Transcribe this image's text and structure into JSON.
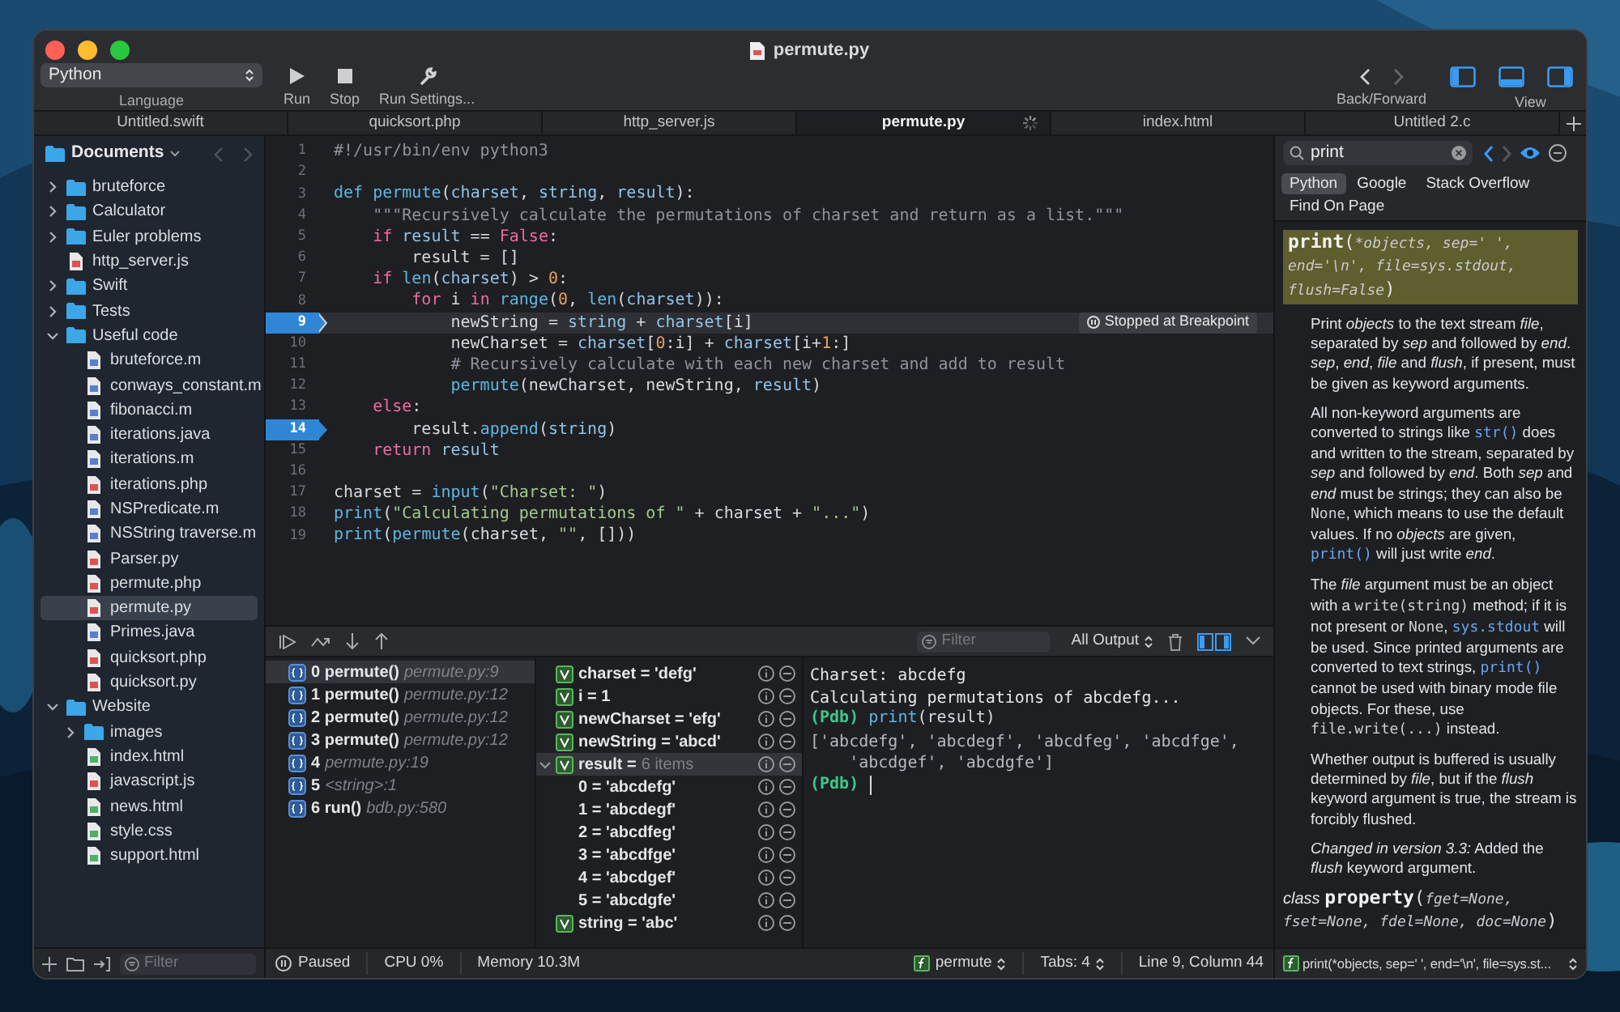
{
  "window": {
    "title": "permute.py"
  },
  "toolbar": {
    "language": "Python",
    "language_label": "Language",
    "buttons": [
      {
        "kind": "run",
        "label": "Run"
      },
      {
        "kind": "stop",
        "label": "Stop"
      },
      {
        "kind": "settings",
        "label": "Run Settings..."
      }
    ],
    "nav_label": "Back/Forward",
    "view_label": "View",
    "view_toggles": [
      {
        "kind": "left",
        "on": true
      },
      {
        "kind": "bottom",
        "on": true
      },
      {
        "kind": "right",
        "on": true
      }
    ]
  },
  "tabs": [
    {
      "label": "Untitled.swift",
      "selected": false,
      "busy": false
    },
    {
      "label": "quicksort.php",
      "selected": false,
      "busy": false
    },
    {
      "label": "http_server.js",
      "selected": false,
      "busy": false
    },
    {
      "label": "permute.py",
      "selected": true,
      "busy": true
    },
    {
      "label": "index.html",
      "selected": false,
      "busy": false
    },
    {
      "label": "Untitled 2.c",
      "selected": false,
      "busy": false
    }
  ],
  "sidebar": {
    "title": "Documents",
    "filter_placeholder": "Filter",
    "items": [
      {
        "label": "bruteforce",
        "kind": "folder",
        "expanded": false,
        "selected": false
      },
      {
        "label": "Calculator",
        "kind": "folder",
        "expanded": false,
        "selected": false
      },
      {
        "label": "Euler problems",
        "kind": "folder",
        "expanded": false,
        "selected": false
      },
      {
        "label": "http_server.js",
        "kind": "js",
        "selected": false
      },
      {
        "label": "Swift",
        "kind": "folder",
        "expanded": false,
        "selected": false
      },
      {
        "label": "Tests",
        "kind": "folder",
        "expanded": false,
        "selected": false
      },
      {
        "label": "Useful code",
        "kind": "folder",
        "expanded": true,
        "selected": false,
        "children": [
          {
            "label": "bruteforce.m",
            "kind": "m",
            "selected": false
          },
          {
            "label": "conways_constant.m",
            "kind": "m",
            "selected": false
          },
          {
            "label": "fibonacci.m",
            "kind": "m",
            "selected": false
          },
          {
            "label": "iterations.java",
            "kind": "java",
            "selected": false
          },
          {
            "label": "iterations.m",
            "kind": "m",
            "selected": false
          },
          {
            "label": "iterations.php",
            "kind": "php",
            "selected": false
          },
          {
            "label": "NSPredicate.m",
            "kind": "m",
            "selected": false
          },
          {
            "label": "NSString traverse.m",
            "kind": "m",
            "selected": false
          },
          {
            "label": "Parser.py",
            "kind": "py",
            "selected": false
          },
          {
            "label": "permute.php",
            "kind": "php",
            "selected": false
          },
          {
            "label": "permute.py",
            "kind": "py",
            "selected": true
          },
          {
            "label": "Primes.java",
            "kind": "java",
            "selected": false
          },
          {
            "label": "quicksort.php",
            "kind": "php",
            "selected": false
          },
          {
            "label": "quicksort.py",
            "kind": "py",
            "selected": false
          }
        ]
      },
      {
        "label": "Website",
        "kind": "folder",
        "expanded": true,
        "selected": false,
        "children": [
          {
            "label": "images",
            "kind": "folder",
            "expanded": false,
            "selected": false
          },
          {
            "label": "index.html",
            "kind": "html",
            "selected": false
          },
          {
            "label": "javascript.js",
            "kind": "js",
            "selected": false
          },
          {
            "label": "news.html",
            "kind": "html",
            "selected": false
          },
          {
            "label": "style.css",
            "kind": "css",
            "selected": false
          },
          {
            "label": "support.html",
            "kind": "html",
            "selected": false
          }
        ]
      }
    ]
  },
  "editor": {
    "badge": "Stopped at Breakpoint",
    "lines": [
      {
        "number": "1",
        "breakpoint": false,
        "current": false,
        "tokens": [
          {
            "t": "#!/usr/bin/env python3",
            "kind": "com"
          }
        ]
      },
      {
        "number": "2",
        "breakpoint": false,
        "current": false
      },
      {
        "number": "3",
        "breakpoint": false,
        "current": false,
        "tokens": [
          {
            "t": "def ",
            "kind": "def"
          },
          {
            "t": "permute",
            "kind": "fn"
          },
          {
            "t": "(",
            "kind": "plain"
          },
          {
            "t": "charset",
            "kind": "var"
          },
          {
            "t": ", ",
            "kind": "plain"
          },
          {
            "t": "string",
            "kind": "var"
          },
          {
            "t": ", ",
            "kind": "plain"
          },
          {
            "t": "result",
            "kind": "var"
          },
          {
            "t": "):",
            "kind": "plain"
          }
        ]
      },
      {
        "number": "4",
        "breakpoint": false,
        "current": false,
        "tokens": [
          {
            "t": "    \"\"\"Recursively calculate the permutations of charset and return as a list.\"\"\"",
            "kind": "com"
          }
        ]
      },
      {
        "number": "5",
        "breakpoint": false,
        "current": false,
        "tokens": [
          {
            "t": "    if ",
            "kind": "kw"
          },
          {
            "t": "result",
            "kind": "var"
          },
          {
            "t": " == ",
            "kind": "plain"
          },
          {
            "t": "False",
            "kind": "kw"
          },
          {
            "t": ":",
            "kind": "plain"
          }
        ]
      },
      {
        "number": "6",
        "breakpoint": false,
        "current": false,
        "tokens": [
          {
            "t": "        result = []",
            "kind": "plain"
          }
        ]
      },
      {
        "number": "7",
        "breakpoint": false,
        "current": false,
        "tokens": [
          {
            "t": "    if ",
            "kind": "kw"
          },
          {
            "t": "len",
            "kind": "fn"
          },
          {
            "t": "(",
            "kind": "plain"
          },
          {
            "t": "charset",
            "kind": "var"
          },
          {
            "t": ") > ",
            "kind": "plain"
          },
          {
            "t": "0",
            "kind": "num"
          },
          {
            "t": ":",
            "kind": "plain"
          }
        ]
      },
      {
        "number": "8",
        "breakpoint": false,
        "current": false,
        "tokens": [
          {
            "t": "        for",
            "kind": "kw"
          },
          {
            "t": " i ",
            "kind": "plain"
          },
          {
            "t": "in ",
            "kind": "kw"
          },
          {
            "t": "range",
            "kind": "fn"
          },
          {
            "t": "(",
            "kind": "plain"
          },
          {
            "t": "0",
            "kind": "num"
          },
          {
            "t": ", ",
            "kind": "plain"
          },
          {
            "t": "len",
            "kind": "fn"
          },
          {
            "t": "(",
            "kind": "plain"
          },
          {
            "t": "charset",
            "kind": "var"
          },
          {
            "t": ")):",
            "kind": "plain"
          }
        ]
      },
      {
        "number": "9",
        "breakpoint": true,
        "current": true,
        "tokens": [
          {
            "t": "            newString = ",
            "kind": "plain"
          },
          {
            "t": "string",
            "kind": "var"
          },
          {
            "t": " + ",
            "kind": "plain"
          },
          {
            "t": "charset",
            "kind": "var"
          },
          {
            "t": "[i]",
            "kind": "plain"
          }
        ]
      },
      {
        "number": "10",
        "breakpoint": false,
        "current": false,
        "tokens": [
          {
            "t": "            newCharset = ",
            "kind": "plain"
          },
          {
            "t": "charset",
            "kind": "var"
          },
          {
            "t": "[",
            "kind": "plain"
          },
          {
            "t": "0",
            "kind": "num"
          },
          {
            "t": ":i] + ",
            "kind": "plain"
          },
          {
            "t": "charset",
            "kind": "var"
          },
          {
            "t": "[i+",
            "kind": "plain"
          },
          {
            "t": "1",
            "kind": "num"
          },
          {
            "t": ":]",
            "kind": "plain"
          }
        ]
      },
      {
        "number": "11",
        "breakpoint": false,
        "current": false,
        "tokens": [
          {
            "t": "            # Recursively calculate with each new charset and add to result",
            "kind": "com"
          }
        ]
      },
      {
        "number": "12",
        "breakpoint": false,
        "current": false,
        "tokens": [
          {
            "t": "            permute",
            "kind": "fn"
          },
          {
            "t": "(newCharset, newString, ",
            "kind": "plain"
          },
          {
            "t": "result",
            "kind": "var"
          },
          {
            "t": ")",
            "kind": "plain"
          }
        ]
      },
      {
        "number": "13",
        "breakpoint": false,
        "current": false,
        "tokens": [
          {
            "t": "    else",
            "kind": "kw"
          },
          {
            "t": ":",
            "kind": "plain"
          }
        ]
      },
      {
        "number": "14",
        "breakpoint": true,
        "current": false,
        "tokens": [
          {
            "t": "        result.",
            "kind": "plain"
          },
          {
            "t": "append",
            "kind": "fn"
          },
          {
            "t": "(",
            "kind": "plain"
          },
          {
            "t": "string",
            "kind": "var"
          },
          {
            "t": ")",
            "kind": "plain"
          }
        ]
      },
      {
        "number": "15",
        "breakpoint": false,
        "current": false,
        "tokens": [
          {
            "t": "    return ",
            "kind": "kw"
          },
          {
            "t": "result",
            "kind": "var"
          }
        ]
      },
      {
        "number": "16",
        "breakpoint": false,
        "current": false
      },
      {
        "number": "17",
        "breakpoint": false,
        "current": false,
        "tokens": [
          {
            "t": "charset = ",
            "kind": "plain"
          },
          {
            "t": "input",
            "kind": "fn"
          },
          {
            "t": "(",
            "kind": "plain"
          },
          {
            "t": "\"Charset: \"",
            "kind": "str"
          },
          {
            "t": ")",
            "kind": "plain"
          }
        ]
      },
      {
        "number": "18",
        "breakpoint": false,
        "current": false,
        "tokens": [
          {
            "t": "print",
            "kind": "fn"
          },
          {
            "t": "(",
            "kind": "plain"
          },
          {
            "t": "\"Calculating permutations of \"",
            "kind": "str"
          },
          {
            "t": " + charset + ",
            "kind": "plain"
          },
          {
            "t": "\"...\"",
            "kind": "str"
          },
          {
            "t": ")",
            "kind": "plain"
          }
        ]
      },
      {
        "number": "19",
        "breakpoint": false,
        "current": false,
        "tokens": [
          {
            "t": "print",
            "kind": "fn"
          },
          {
            "t": "(",
            "kind": "plain"
          },
          {
            "t": "permute",
            "kind": "fn"
          },
          {
            "t": "(charset, ",
            "kind": "plain"
          },
          {
            "t": "\"\"",
            "kind": "str"
          },
          {
            "t": ", []))",
            "kind": "plain"
          }
        ]
      }
    ]
  },
  "debugger": {
    "filter_placeholder": "Filter",
    "output_select": "All Output",
    "stack": [
      {
        "label": "0 permute()",
        "location": "permute.py:9",
        "selected": true
      },
      {
        "label": "1 permute()",
        "location": "permute.py:12",
        "selected": false
      },
      {
        "label": "2 permute()",
        "location": "permute.py:12",
        "selected": false
      },
      {
        "label": "3 permute()",
        "location": "permute.py:12",
        "selected": false
      },
      {
        "label": "4",
        "location": "permute.py:19",
        "selected": false
      },
      {
        "label": "5",
        "location": "<string>:1",
        "selected": false
      },
      {
        "label": "6 run()",
        "location": "bdb.py:580",
        "selected": false
      }
    ],
    "variables": [
      {
        "label": "charset = 'defg'",
        "kind": "var",
        "selected": false
      },
      {
        "label": "i = 1",
        "kind": "var",
        "selected": false
      },
      {
        "label": "newCharset = 'efg'",
        "kind": "var",
        "selected": false
      },
      {
        "label": "newString = 'abcd'",
        "kind": "var",
        "selected": false
      },
      {
        "label": "result =",
        "summary": "6 items",
        "kind": "var",
        "expanded": true,
        "selected": true,
        "children": [
          {
            "label": "0 = 'abcdefg'",
            "kind": "item",
            "selected": false
          },
          {
            "label": "1 = 'abcdegf'",
            "kind": "item",
            "selected": false
          },
          {
            "label": "2 = 'abcdfeg'",
            "kind": "item",
            "selected": false
          },
          {
            "label": "3 = 'abcdfge'",
            "kind": "item",
            "selected": false
          },
          {
            "label": "4 = 'abcdgef'",
            "kind": "item",
            "selected": false
          },
          {
            "label": "5 = 'abcdgfe'",
            "kind": "item",
            "selected": false
          }
        ]
      },
      {
        "label": "string = 'abc'",
        "kind": "var",
        "selected": false
      }
    ],
    "console": [
      {
        "kind": "output",
        "text": "Charset: abcdefg"
      },
      {
        "kind": "output",
        "text": "Calculating permutations of abcdefg..."
      },
      {
        "kind": "prompt",
        "prompt": "(Pdb)",
        "command": [
          {
            "t": "print",
            "kind": "fn"
          },
          {
            "t": "(result)",
            "kind": "plain"
          }
        ]
      },
      {
        "kind": "result",
        "text": "['abcdefg', 'abcdegf', 'abcdfeg', 'abcdfge',"
      },
      {
        "kind": "result",
        "text": "    'abcdgef', 'abcdgfe']"
      },
      {
        "kind": "prompt",
        "prompt": "(Pdb)",
        "cursor": true
      }
    ]
  },
  "status_bar": {
    "state": "Paused",
    "cpu": "CPU 0%",
    "memory": "Memory 10.3M",
    "function": "permute",
    "tabs": "Tabs: 4",
    "position": "Line 9, Column 44"
  },
  "docs": {
    "search": "print",
    "scopes": [
      {
        "label": "Python",
        "selected": true
      },
      {
        "label": "Google",
        "selected": false
      },
      {
        "label": "Stack Overflow",
        "selected": false
      },
      {
        "label": "Find On Page",
        "selected": false
      }
    ],
    "signature": [
      {
        "t": "print",
        "kind": "name"
      },
      {
        "t": "(",
        "kind": "punct"
      },
      {
        "t": "*objects, sep=' ', end='\\n', file=sys.stdout, flush=False",
        "kind": "arg"
      },
      {
        "t": ")",
        "kind": "punct"
      }
    ],
    "paragraphs": [
      [
        {
          "t": "Print ",
          "kind": "plain"
        },
        {
          "t": "objects",
          "kind": "em"
        },
        {
          "t": " to the text stream ",
          "kind": "plain"
        },
        {
          "t": "file",
          "kind": "em"
        },
        {
          "t": ", separated by ",
          "kind": "plain"
        },
        {
          "t": "sep",
          "kind": "em"
        },
        {
          "t": " and followed by ",
          "kind": "plain"
        },
        {
          "t": "end",
          "kind": "em"
        },
        {
          "t": ". ",
          "kind": "plain"
        },
        {
          "t": "sep",
          "kind": "em"
        },
        {
          "t": ", ",
          "kind": "plain"
        },
        {
          "t": "end",
          "kind": "em"
        },
        {
          "t": ", ",
          "kind": "plain"
        },
        {
          "t": "file",
          "kind": "em"
        },
        {
          "t": " and ",
          "kind": "plain"
        },
        {
          "t": "flush",
          "kind": "em"
        },
        {
          "t": ", if present, must be given as keyword arguments.",
          "kind": "plain"
        }
      ],
      [
        {
          "t": "All non-keyword arguments are converted to strings like ",
          "kind": "plain"
        },
        {
          "t": "str()",
          "kind": "link"
        },
        {
          "t": " does and written to the stream, separated by ",
          "kind": "plain"
        },
        {
          "t": "sep",
          "kind": "em"
        },
        {
          "t": " and followed by ",
          "kind": "plain"
        },
        {
          "t": "end",
          "kind": "em"
        },
        {
          "t": ". Both ",
          "kind": "plain"
        },
        {
          "t": "sep",
          "kind": "em"
        },
        {
          "t": " and ",
          "kind": "plain"
        },
        {
          "t": "end",
          "kind": "em"
        },
        {
          "t": " must be strings; they can also be ",
          "kind": "plain"
        },
        {
          "t": "None",
          "kind": "code"
        },
        {
          "t": ", which means to use the default values. If no ",
          "kind": "plain"
        },
        {
          "t": "objects",
          "kind": "em"
        },
        {
          "t": " are given, ",
          "kind": "plain"
        },
        {
          "t": "print()",
          "kind": "link"
        },
        {
          "t": " will just write ",
          "kind": "plain"
        },
        {
          "t": "end",
          "kind": "em"
        },
        {
          "t": ".",
          "kind": "plain"
        }
      ],
      [
        {
          "t": "The ",
          "kind": "plain"
        },
        {
          "t": "file",
          "kind": "em"
        },
        {
          "t": " argument must be an object with a ",
          "kind": "plain"
        },
        {
          "t": "write(string)",
          "kind": "code"
        },
        {
          "t": " method; if it is not present or ",
          "kind": "plain"
        },
        {
          "t": "None",
          "kind": "code"
        },
        {
          "t": ", ",
          "kind": "plain"
        },
        {
          "t": "sys.stdout",
          "kind": "link"
        },
        {
          "t": " will be used. Since printed arguments are converted to text strings, ",
          "kind": "plain"
        },
        {
          "t": "print()",
          "kind": "link"
        },
        {
          "t": " cannot be used with binary mode file objects. For these, use ",
          "kind": "plain"
        },
        {
          "t": "file.write(...)",
          "kind": "code"
        },
        {
          "t": " instead.",
          "kind": "plain"
        }
      ],
      [
        {
          "t": "Whether output is buffered is usually determined by ",
          "kind": "plain"
        },
        {
          "t": "file",
          "kind": "em"
        },
        {
          "t": ", but if the ",
          "kind": "plain"
        },
        {
          "t": "flush",
          "kind": "em"
        },
        {
          "t": " keyword argument is true, the stream is forcibly flushed.",
          "kind": "plain"
        }
      ],
      [
        {
          "t": "Changed in version 3.3:",
          "kind": "em"
        },
        {
          "t": " Added the ",
          "kind": "plain"
        },
        {
          "t": "flush",
          "kind": "em"
        },
        {
          "t": " keyword argument.",
          "kind": "plain"
        }
      ]
    ],
    "next_signature": [
      {
        "t": "class ",
        "kind": "em"
      },
      {
        "t": "property",
        "kind": "name"
      },
      {
        "t": "(",
        "kind": "punct"
      },
      {
        "t": "fget=None, fset=None, fdel=None, doc=None",
        "kind": "arg"
      },
      {
        "t": ")",
        "kind": "punct"
      }
    ],
    "footer": "print(*objects, sep=' ', end='\\n', file=sys.st..."
  }
}
